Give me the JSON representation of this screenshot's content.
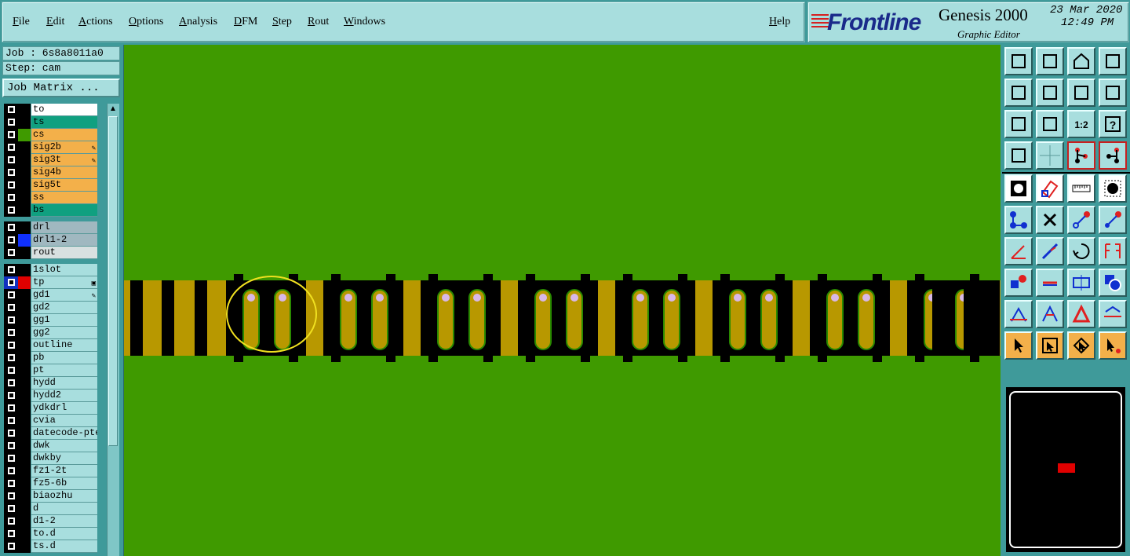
{
  "menu": {
    "items": [
      "File",
      "Edit",
      "Actions",
      "Options",
      "Analysis",
      "DFM",
      "Step",
      "Rout",
      "Windows"
    ],
    "help": "Help"
  },
  "brand": {
    "logo": "Frontline",
    "title": "Genesis 2000",
    "subtitle": "Graphic Editor",
    "date": "23 Mar 2020",
    "time": "12:49 PM"
  },
  "job": {
    "job_label": "Job : 6s8a8011a0",
    "step_label": "Step: cam",
    "matrix_button": "Job Matrix ..."
  },
  "layers": [
    {
      "name": "to",
      "bg": "#ffffff",
      "color": "#000000"
    },
    {
      "name": "ts",
      "bg": "#10a080",
      "color": "#000000"
    },
    {
      "name": "cs",
      "bg": "#f3b04a",
      "color": "#3f9a00"
    },
    {
      "name": "sig2b",
      "bg": "#f3b04a",
      "color": "#000000",
      "flag": "✎"
    },
    {
      "name": "sig3t",
      "bg": "#f3b04a",
      "color": "#000000",
      "flag": "✎"
    },
    {
      "name": "sig4b",
      "bg": "#f3b04a",
      "color": "#000000"
    },
    {
      "name": "sig5t",
      "bg": "#f3b04a",
      "color": "#000000"
    },
    {
      "name": "ss",
      "bg": "#f3b04a",
      "color": "#000000"
    },
    {
      "name": "bs",
      "bg": "#10a080",
      "color": "#000000"
    },
    {
      "name": "drl",
      "bg": "#a0b8c0",
      "color": "#000000",
      "gap": true
    },
    {
      "name": "drl1-2",
      "bg": "#a0b8c0",
      "color": "#1030ff"
    },
    {
      "name": "rout",
      "bg": "#d8e0e0",
      "color": "#000000"
    },
    {
      "name": "1slot",
      "bg": "#a8dede",
      "color": "#000000",
      "gap": true
    },
    {
      "name": "tp",
      "bg": "#a8dede",
      "color": "#e00000",
      "flag": "▣",
      "active": true
    },
    {
      "name": "gd1",
      "bg": "#a8dede",
      "color": "#000000",
      "flag": "✎"
    },
    {
      "name": "gd2",
      "bg": "#a8dede",
      "color": "#000000"
    },
    {
      "name": "gg1",
      "bg": "#a8dede",
      "color": "#000000"
    },
    {
      "name": "gg2",
      "bg": "#a8dede",
      "color": "#000000"
    },
    {
      "name": "outline",
      "bg": "#a8dede",
      "color": "#000000"
    },
    {
      "name": "pb",
      "bg": "#a8dede",
      "color": "#000000"
    },
    {
      "name": "pt",
      "bg": "#a8dede",
      "color": "#000000"
    },
    {
      "name": "hydd",
      "bg": "#a8dede",
      "color": "#000000"
    },
    {
      "name": "hydd2",
      "bg": "#a8dede",
      "color": "#000000"
    },
    {
      "name": "ydkdrl",
      "bg": "#a8dede",
      "color": "#000000"
    },
    {
      "name": "cvia",
      "bg": "#a8dede",
      "color": "#000000"
    },
    {
      "name": "datecode-pte",
      "bg": "#a8dede",
      "color": "#000000"
    },
    {
      "name": "dwk",
      "bg": "#a8dede",
      "color": "#000000"
    },
    {
      "name": "dwkby",
      "bg": "#a8dede",
      "color": "#000000"
    },
    {
      "name": "fz1-2t",
      "bg": "#a8dede",
      "color": "#000000"
    },
    {
      "name": "fz5-6b",
      "bg": "#a8dede",
      "color": "#000000"
    },
    {
      "name": "biaozhu",
      "bg": "#a8dede",
      "color": "#000000"
    },
    {
      "name": "d",
      "bg": "#a8dede",
      "color": "#000000"
    },
    {
      "name": "d1-2",
      "bg": "#a8dede",
      "color": "#000000"
    },
    {
      "name": "to.d",
      "bg": "#a8dede",
      "color": "#000000"
    },
    {
      "name": "ts.d",
      "bg": "#a8dede",
      "color": "#000000"
    }
  ],
  "canvas": {
    "background": "#3f9a00",
    "copper": "#b89800",
    "mask": "#000000",
    "highlight": "#f0e020"
  },
  "tools": [
    {
      "icon": "zoom-home-icon"
    },
    {
      "icon": "zoom-down-icon"
    },
    {
      "icon": "home-icon"
    },
    {
      "icon": "window-icon"
    },
    {
      "icon": "pan-left-icon"
    },
    {
      "icon": "pan-right-icon"
    },
    {
      "icon": "undo-view-icon"
    },
    {
      "icon": "route-icon"
    },
    {
      "icon": "fit-icon"
    },
    {
      "icon": "center-icon"
    },
    {
      "icon": "ratio-icon",
      "label": "1:2"
    },
    {
      "icon": "help-icon"
    },
    {
      "icon": "settings-icon"
    },
    {
      "icon": "grid-icon"
    },
    {
      "icon": "net-icon",
      "red": true
    },
    {
      "icon": "net-edit-icon",
      "red": true
    },
    {
      "icon": "select-box-icon",
      "white": true
    },
    {
      "icon": "transform-icon",
      "white": true
    },
    {
      "icon": "ruler-icon",
      "white": true
    },
    {
      "icon": "pad-icon",
      "white": true
    },
    {
      "icon": "connect-icon"
    },
    {
      "icon": "delete-icon"
    },
    {
      "icon": "point-icon"
    },
    {
      "icon": "add-point-icon"
    },
    {
      "icon": "angle-icon"
    },
    {
      "icon": "line-edit-icon"
    },
    {
      "icon": "rotate-icon"
    },
    {
      "icon": "flip-icon"
    },
    {
      "icon": "feature-icon"
    },
    {
      "icon": "minus-icon"
    },
    {
      "icon": "measure-icon"
    },
    {
      "icon": "shapes-icon"
    },
    {
      "icon": "arc-icon"
    },
    {
      "icon": "arc2-icon"
    },
    {
      "icon": "arc3-icon"
    },
    {
      "icon": "arc4-icon"
    },
    {
      "icon": "pointer-icon",
      "orange": true
    },
    {
      "icon": "select-icon",
      "orange": true
    },
    {
      "icon": "select2-icon",
      "orange": true
    },
    {
      "icon": "select3-icon",
      "orange": true
    }
  ]
}
